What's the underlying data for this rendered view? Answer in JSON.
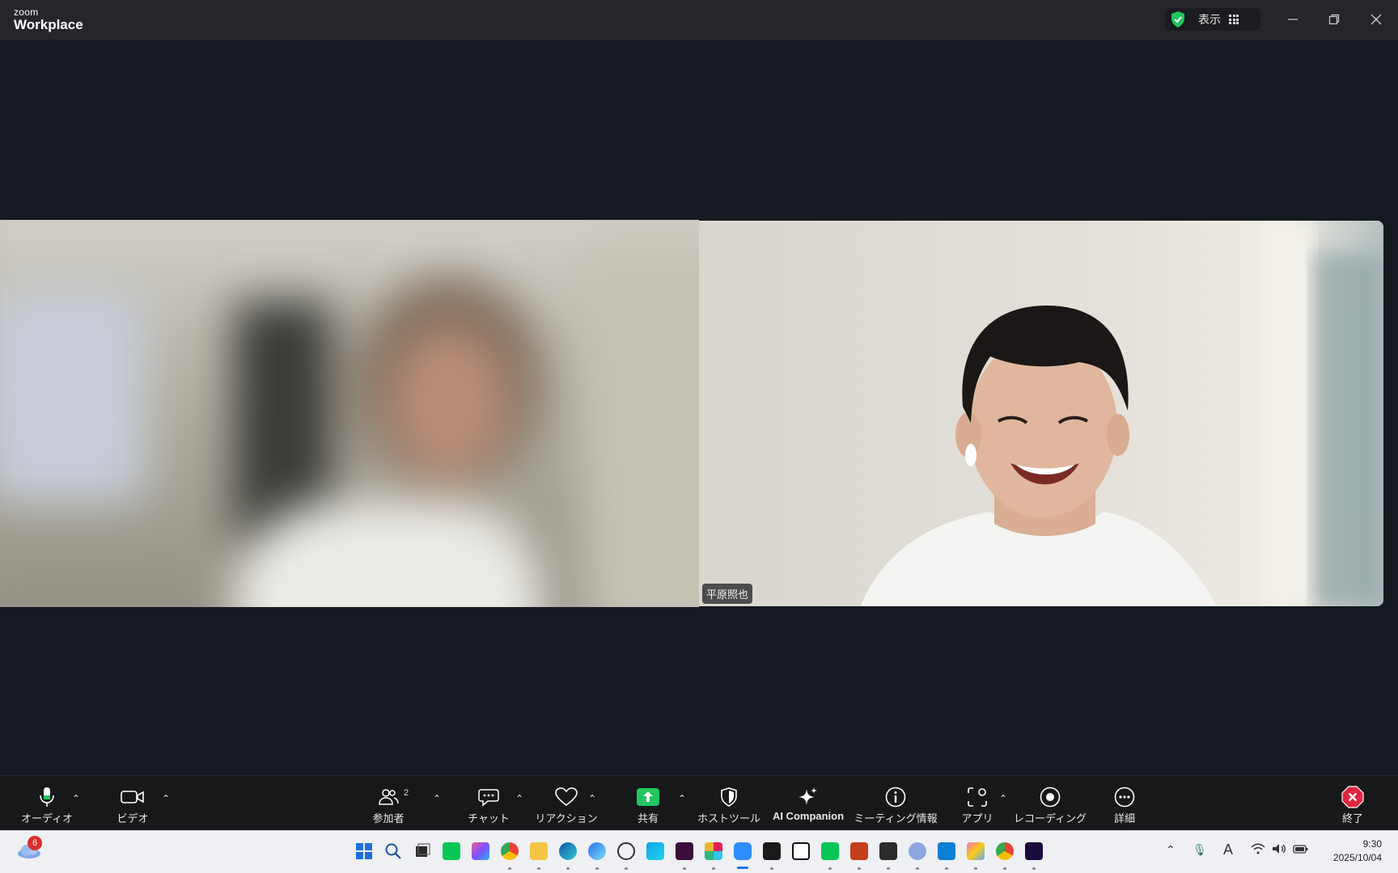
{
  "window": {
    "app_small": "zoom",
    "app_big": "Workplace",
    "view_label": "表示",
    "icons": [
      "shield-check-icon",
      "grid-icon",
      "minimize-icon",
      "restore-icon",
      "close-icon"
    ]
  },
  "participants": {
    "right_name": "平原照也"
  },
  "toolbar": {
    "audio": "オーディオ",
    "video": "ビデオ",
    "participants": "参加者",
    "participants_count": "2",
    "chat": "チャット",
    "reactions": "リアクション",
    "share": "共有",
    "host_tools": "ホストツール",
    "ai_companion": "AI Companion",
    "meeting_info": "ミーティング情報",
    "apps": "アプリ",
    "recording": "レコーディング",
    "more": "詳細",
    "end": "終了"
  },
  "colors": {
    "accent_green": "#22c55e",
    "end_red": "#e0263e",
    "toolbar_bg": "#161819",
    "titlebar_bg": "#242629"
  },
  "taskbar": {
    "weather_badge": "6",
    "time": "9:30",
    "date": "2025/10/04"
  }
}
